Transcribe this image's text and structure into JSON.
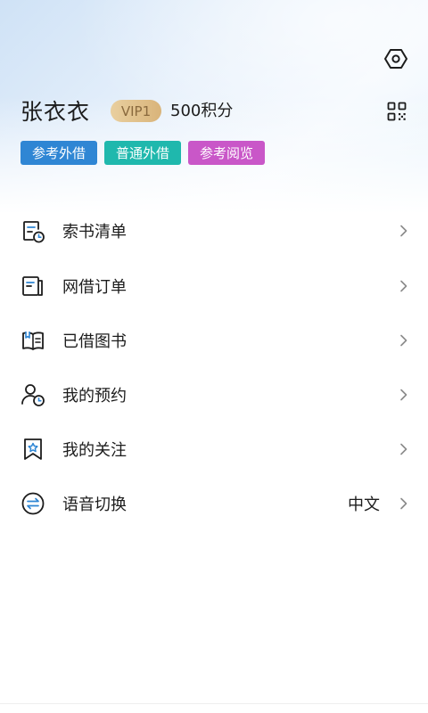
{
  "colors": {
    "accent_blue": "#2f86d4",
    "tag_teal": "#1fb8ad",
    "tag_purple": "#c957c8",
    "vip_gold": "#d9b47a",
    "icon_blue": "#2f86d4",
    "text_primary": "#1c1c1c"
  },
  "header": {
    "settings_icon": "settings-hexagon-icon",
    "qr_icon": "qr-code-icon"
  },
  "profile": {
    "name": "张衣衣",
    "vip_label": "VIP1",
    "points": "500积分",
    "tags": [
      "参考外借",
      "普通外借",
      "参考阅览"
    ]
  },
  "menu": {
    "items": [
      {
        "label": "索书清单",
        "icon": "request-list-icon"
      },
      {
        "label": "网借订单",
        "icon": "online-order-icon"
      },
      {
        "label": "已借图书",
        "icon": "borrowed-book-icon"
      },
      {
        "label": "我的预约",
        "icon": "reservation-icon"
      },
      {
        "label": "我的关注",
        "icon": "bookmark-star-icon"
      },
      {
        "label": "语音切换",
        "icon": "language-switch-icon",
        "value": "中文"
      }
    ]
  }
}
